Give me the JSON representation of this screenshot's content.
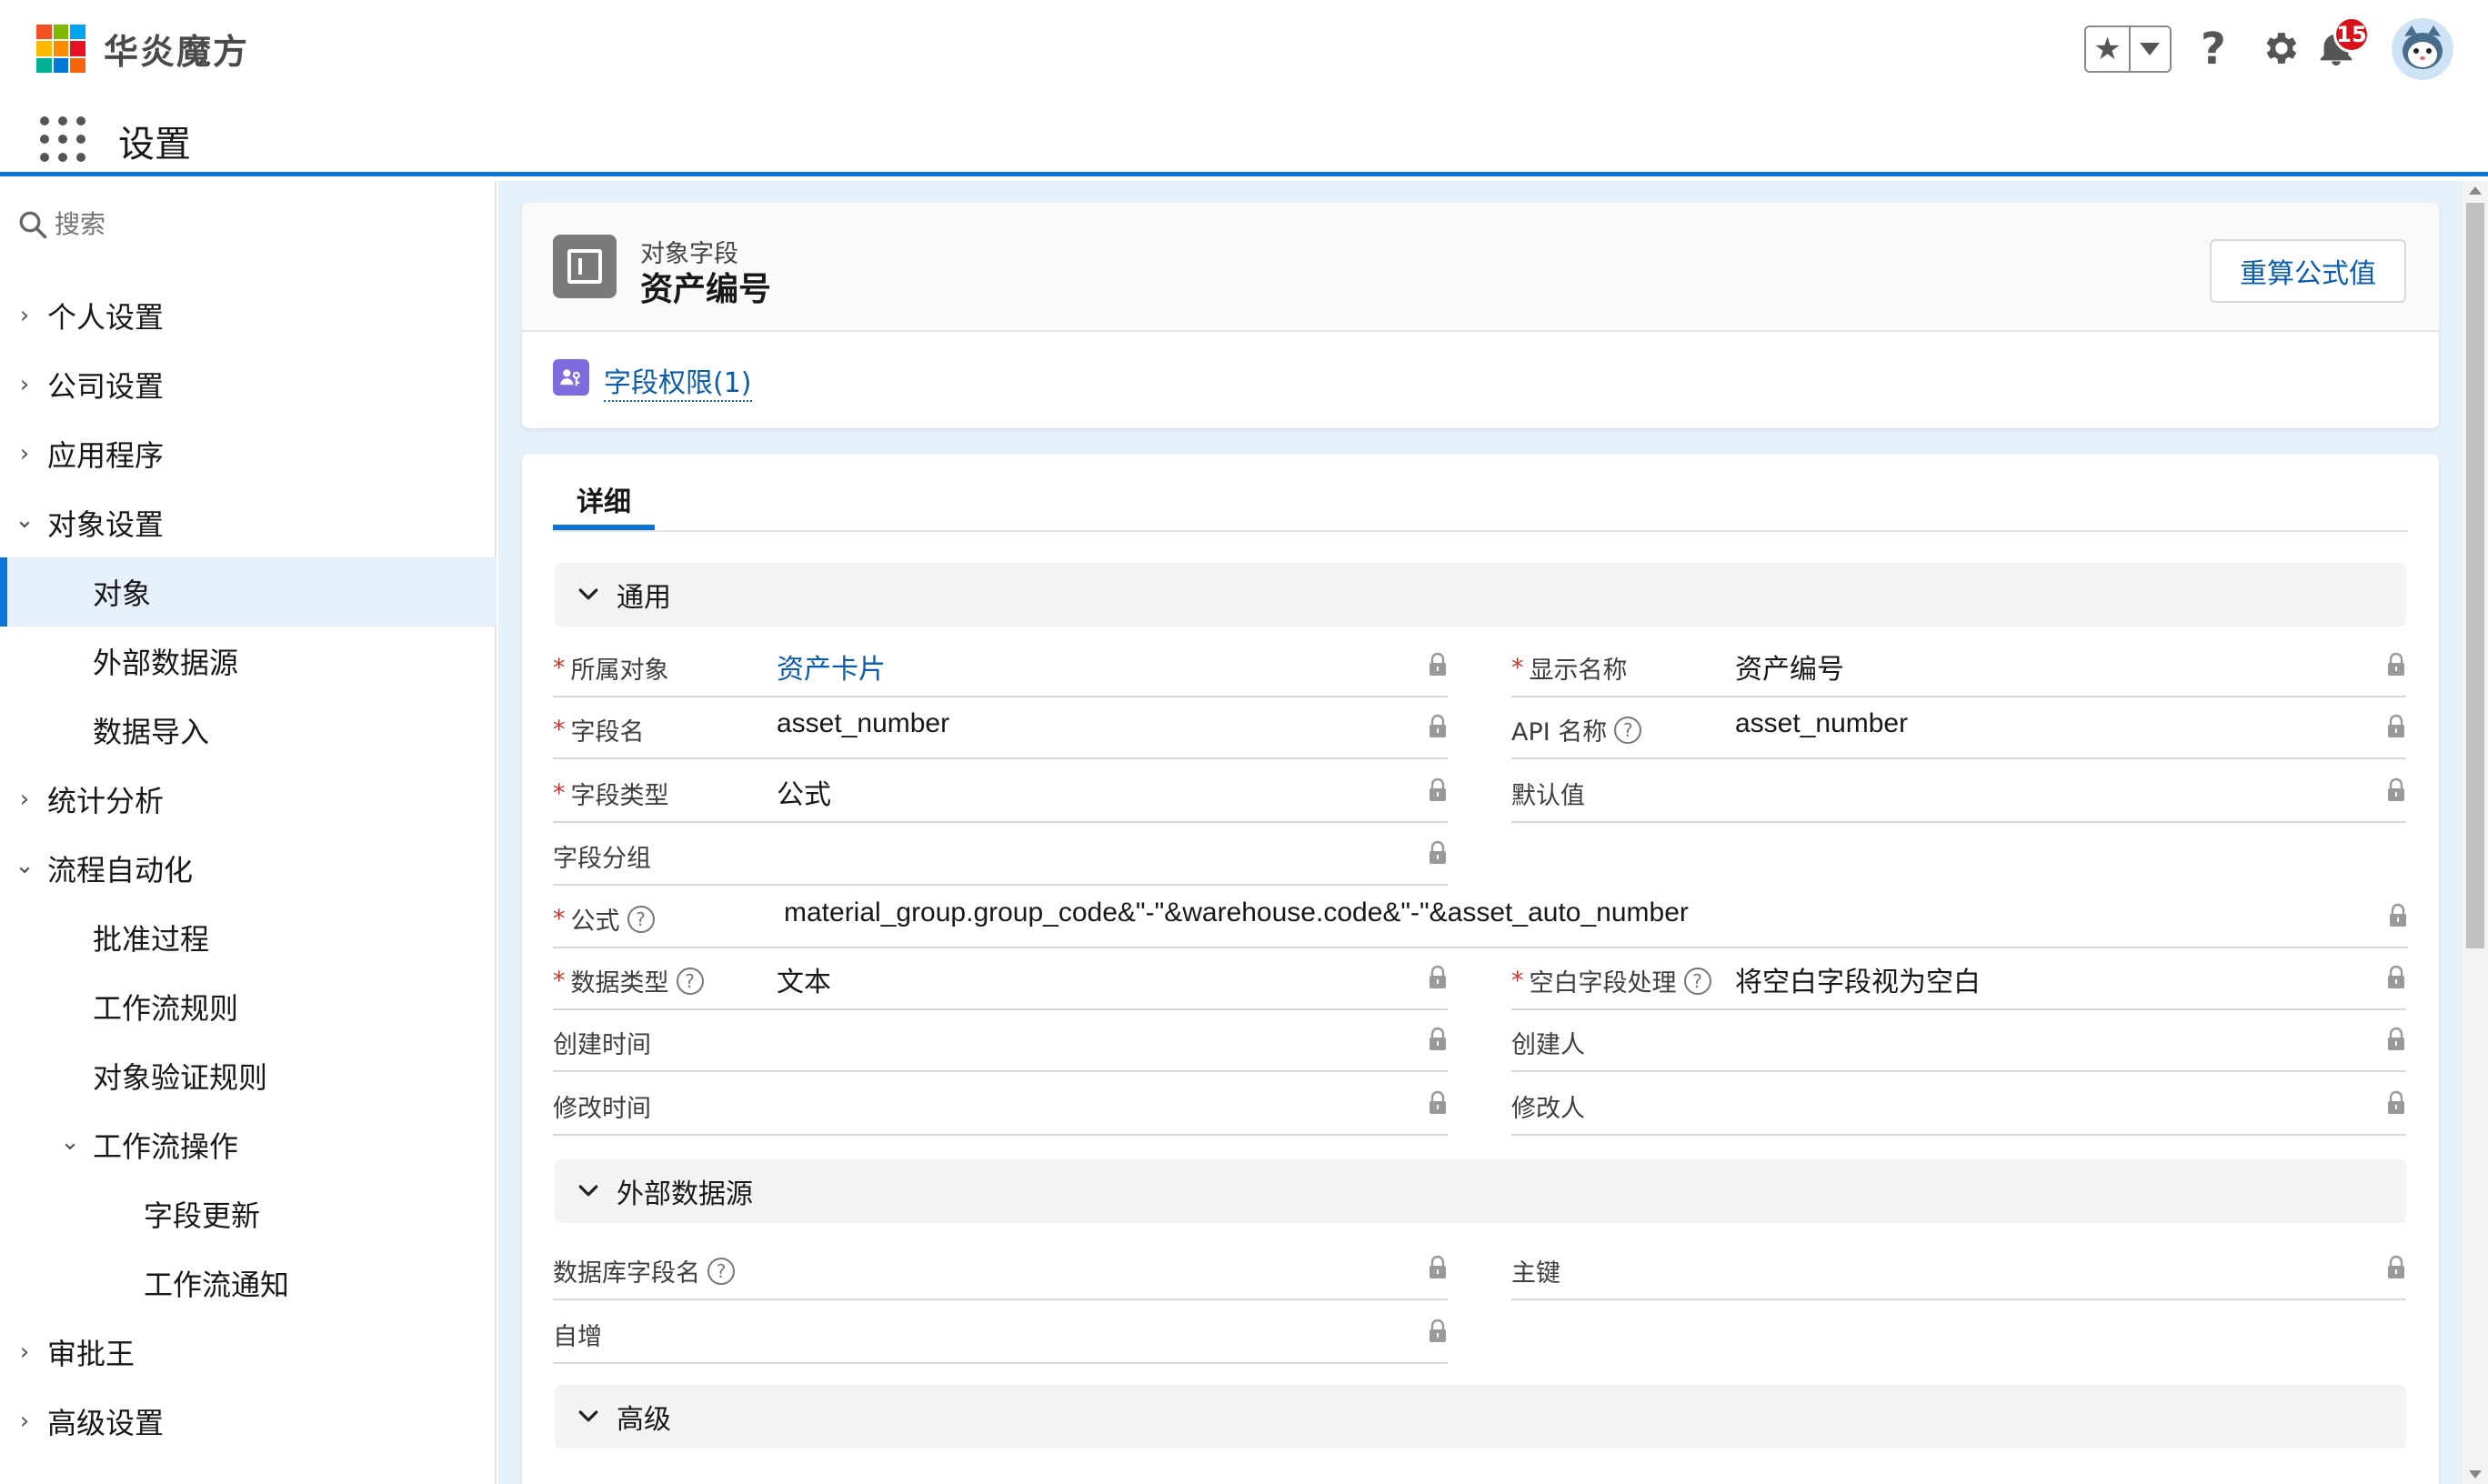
{
  "brand": {
    "name": "华炎魔方",
    "logo_colors": [
      "#f25022",
      "#7fba00",
      "#00a4ef",
      "#ffb900",
      "#ff8c00",
      "#e81123",
      "#00b294",
      "#0078d7",
      "#f7630c"
    ]
  },
  "header": {
    "app_title": "设置",
    "notifications_count": "15",
    "help_glyph": "?",
    "favorites_glyph": "★"
  },
  "sidebar": {
    "search_placeholder": "搜索",
    "items": [
      {
        "label": "个人设置",
        "level": 0,
        "expand": "collapsed"
      },
      {
        "label": "公司设置",
        "level": 0,
        "expand": "collapsed"
      },
      {
        "label": "应用程序",
        "level": 0,
        "expand": "collapsed"
      },
      {
        "label": "对象设置",
        "level": 0,
        "expand": "expanded"
      },
      {
        "label": "对象",
        "level": 1,
        "expand": "none",
        "active": true
      },
      {
        "label": "外部数据源",
        "level": 1,
        "expand": "none"
      },
      {
        "label": "数据导入",
        "level": 1,
        "expand": "none"
      },
      {
        "label": "统计分析",
        "level": 0,
        "expand": "collapsed"
      },
      {
        "label": "流程自动化",
        "level": 0,
        "expand": "expanded"
      },
      {
        "label": "批准过程",
        "level": 1,
        "expand": "none"
      },
      {
        "label": "工作流规则",
        "level": 1,
        "expand": "none"
      },
      {
        "label": "对象验证规则",
        "level": 1,
        "expand": "none"
      },
      {
        "label": "工作流操作",
        "level": 1,
        "expand": "expanded"
      },
      {
        "label": "字段更新",
        "level": 2,
        "expand": "none"
      },
      {
        "label": "工作流通知",
        "level": 2,
        "expand": "none"
      },
      {
        "label": "审批王",
        "level": 0,
        "expand": "collapsed"
      },
      {
        "label": "高级设置",
        "level": 0,
        "expand": "collapsed"
      }
    ]
  },
  "record": {
    "object_type": "对象字段",
    "name": "资产编号",
    "recalc_button": "重算公式值",
    "related_link": "字段权限(1)",
    "tab": "详细"
  },
  "sections": {
    "general": "通用",
    "external": "外部数据源",
    "advanced": "高级"
  },
  "fields": {
    "owner_object": {
      "label": "所属对象",
      "value": "资产卡片",
      "required": true
    },
    "display_name": {
      "label": "显示名称",
      "value": "资产编号",
      "required": true
    },
    "field_name": {
      "label": "字段名",
      "value": "asset_number",
      "required": true
    },
    "api_name": {
      "label": "API 名称",
      "value": "asset_number"
    },
    "field_type": {
      "label": "字段类型",
      "value": "公式",
      "required": true
    },
    "default_value": {
      "label": "默认值",
      "value": ""
    },
    "field_group": {
      "label": "字段分组",
      "value": ""
    },
    "formula": {
      "label": "公式",
      "value": "material_group.group_code&\"-\"&warehouse.code&\"-\"&asset_auto_number",
      "required": true
    },
    "data_type": {
      "label": "数据类型",
      "value": "文本",
      "required": true
    },
    "blank_handling": {
      "label": "空白字段处理",
      "value": "将空白字段视为空白",
      "required": true
    },
    "created_time": {
      "label": "创建时间",
      "value": ""
    },
    "created_by": {
      "label": "创建人",
      "value": ""
    },
    "modified_time": {
      "label": "修改时间",
      "value": ""
    },
    "modified_by": {
      "label": "修改人",
      "value": ""
    },
    "db_field_name": {
      "label": "数据库字段名",
      "value": ""
    },
    "primary_key": {
      "label": "主键",
      "value": ""
    },
    "auto_increment": {
      "label": "自增",
      "value": ""
    }
  },
  "colors": {
    "accent": "#0b74d8",
    "link": "#0b5cad",
    "required": "#c23934",
    "badge": "#d8121a",
    "main_bg": "#e6f0fb"
  }
}
